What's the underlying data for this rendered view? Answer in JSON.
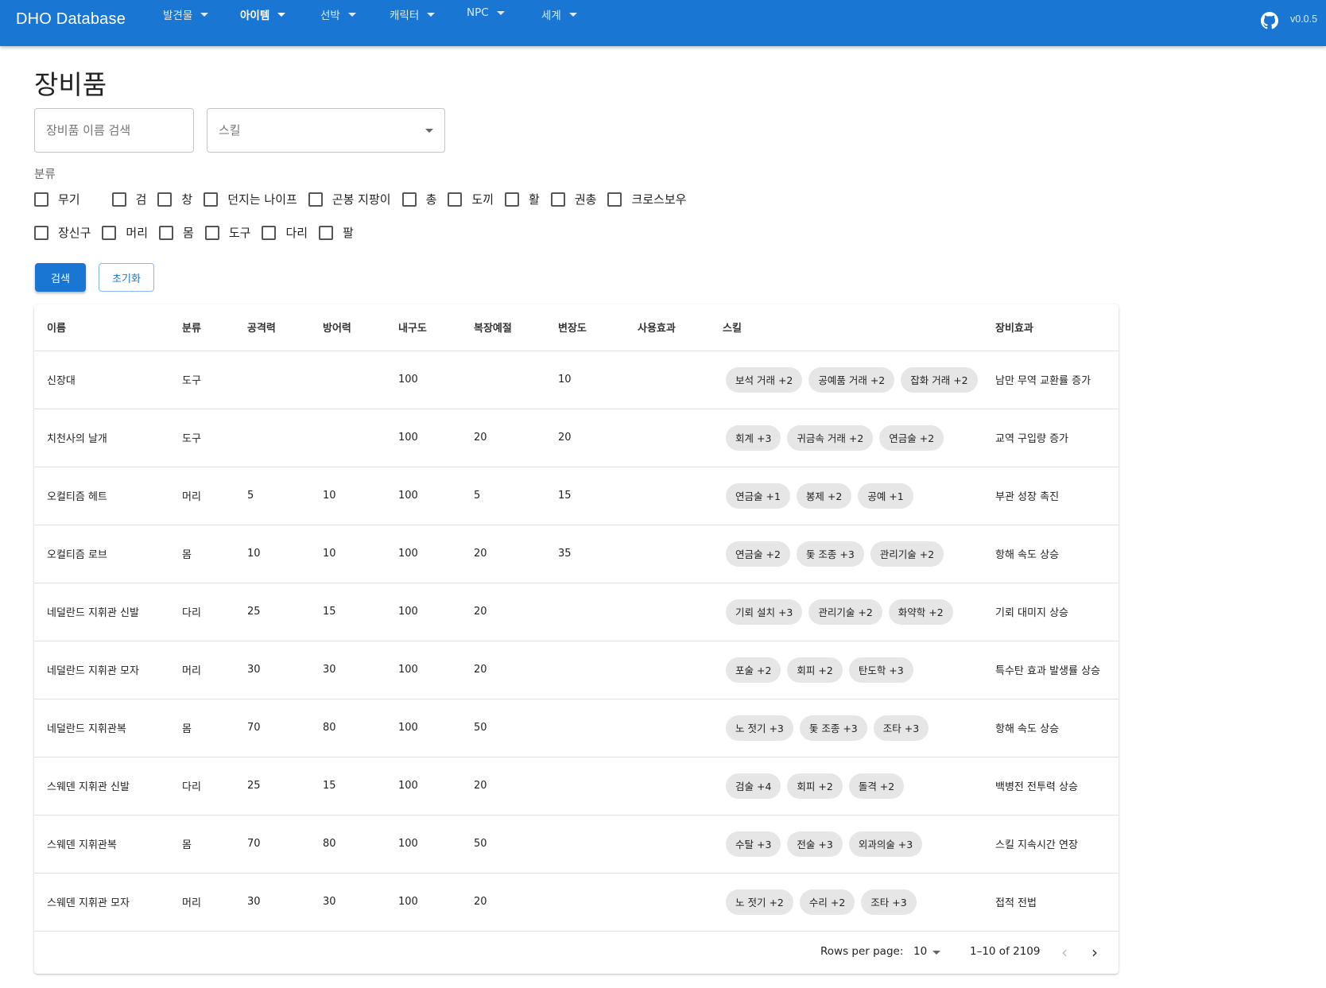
{
  "app": {
    "title": "DHO Database",
    "version": "v0.0.5"
  },
  "nav": [
    {
      "label": "발견물"
    },
    {
      "label": "아이템"
    },
    {
      "label": "선박"
    },
    {
      "label": "캐릭터"
    },
    {
      "label": "NPC"
    },
    {
      "label": "세계"
    }
  ],
  "page": {
    "title": "장비품"
  },
  "search": {
    "placeholder": "장비품 이름 검색",
    "skill_label": "스킬"
  },
  "filters": {
    "label": "분류",
    "row1": [
      "무기",
      "검",
      "창",
      "던지는 나이프",
      "곤봉 지팡이",
      "총",
      "도끼",
      "활",
      "권총",
      "크로스보우"
    ],
    "row2": [
      "장신구",
      "머리",
      "몸",
      "도구",
      "다리",
      "팔"
    ]
  },
  "buttons": {
    "search": "검색",
    "reset": "초기화"
  },
  "table": {
    "headers": [
      "이름",
      "분류",
      "공격력",
      "방어력",
      "내구도",
      "복장예절",
      "변장도",
      "사용효과",
      "스킬",
      "장비효과"
    ],
    "rows": [
      {
        "name": "신장대",
        "category": "도구",
        "attack": "",
        "defense": "",
        "durability": "100",
        "dress": "",
        "disguise": "10",
        "use": "",
        "skills": [
          "보석 거래 +2",
          "공예품 거래 +2",
          "잡화 거래 +2"
        ],
        "effect": "남만 무역 교환률 증가"
      },
      {
        "name": "치천사의 날개",
        "category": "도구",
        "attack": "",
        "defense": "",
        "durability": "100",
        "dress": "20",
        "disguise": "20",
        "use": "",
        "skills": [
          "회계 +3",
          "귀금속 거래 +2",
          "연금술 +2"
        ],
        "effect": "교역 구입량 증가"
      },
      {
        "name": "오컬티즘 헤트",
        "category": "머리",
        "attack": "5",
        "defense": "10",
        "durability": "100",
        "dress": "5",
        "disguise": "15",
        "use": "",
        "skills": [
          "연금술 +1",
          "봉제 +2",
          "공예 +1"
        ],
        "effect": "부관 성장 촉진"
      },
      {
        "name": "오컬티즘 로브",
        "category": "몸",
        "attack": "10",
        "defense": "10",
        "durability": "100",
        "dress": "20",
        "disguise": "35",
        "use": "",
        "skills": [
          "연금술 +2",
          "돛 조종 +3",
          "관리기술 +2"
        ],
        "effect": "항해 속도 상승"
      },
      {
        "name": "네덜란드 지휘관 신발",
        "category": "다리",
        "attack": "25",
        "defense": "15",
        "durability": "100",
        "dress": "20",
        "disguise": "",
        "use": "",
        "skills": [
          "기뢰 설치 +3",
          "관리기술 +2",
          "화약학 +2"
        ],
        "effect": "기뢰 대미지 상승"
      },
      {
        "name": "네덜란드 지휘관 모자",
        "category": "머리",
        "attack": "30",
        "defense": "30",
        "durability": "100",
        "dress": "20",
        "disguise": "",
        "use": "",
        "skills": [
          "포술 +2",
          "회피 +2",
          "탄도학 +3"
        ],
        "effect": "특수탄 효과 발생률 상승"
      },
      {
        "name": "네덜란드 지휘관복",
        "category": "몸",
        "attack": "70",
        "defense": "80",
        "durability": "100",
        "dress": "50",
        "disguise": "",
        "use": "",
        "skills": [
          "노 젓기 +3",
          "돛 조종 +3",
          "조타 +3"
        ],
        "effect": "항해 속도 상승"
      },
      {
        "name": "스웨덴 지휘관 신발",
        "category": "다리",
        "attack": "25",
        "defense": "15",
        "durability": "100",
        "dress": "20",
        "disguise": "",
        "use": "",
        "skills": [
          "검술 +4",
          "회피 +2",
          "돌격 +2"
        ],
        "effect": "백병전 전투력 상승"
      },
      {
        "name": "스웨덴 지휘관복",
        "category": "몸",
        "attack": "70",
        "defense": "80",
        "durability": "100",
        "dress": "50",
        "disguise": "",
        "use": "",
        "skills": [
          "수탈 +3",
          "전술 +3",
          "외과의술 +3"
        ],
        "effect": "스킬 지속시간 연장"
      },
      {
        "name": "스웨덴 지휘관 모자",
        "category": "머리",
        "attack": "30",
        "defense": "30",
        "durability": "100",
        "dress": "20",
        "disguise": "",
        "use": "",
        "skills": [
          "노 젓기 +2",
          "수리 +2",
          "조타 +3"
        ],
        "effect": "접적 전법"
      }
    ]
  },
  "pagination": {
    "rows_per_page_label": "Rows per page:",
    "rows_per_page": "10",
    "range": "1–10 of 2109"
  }
}
